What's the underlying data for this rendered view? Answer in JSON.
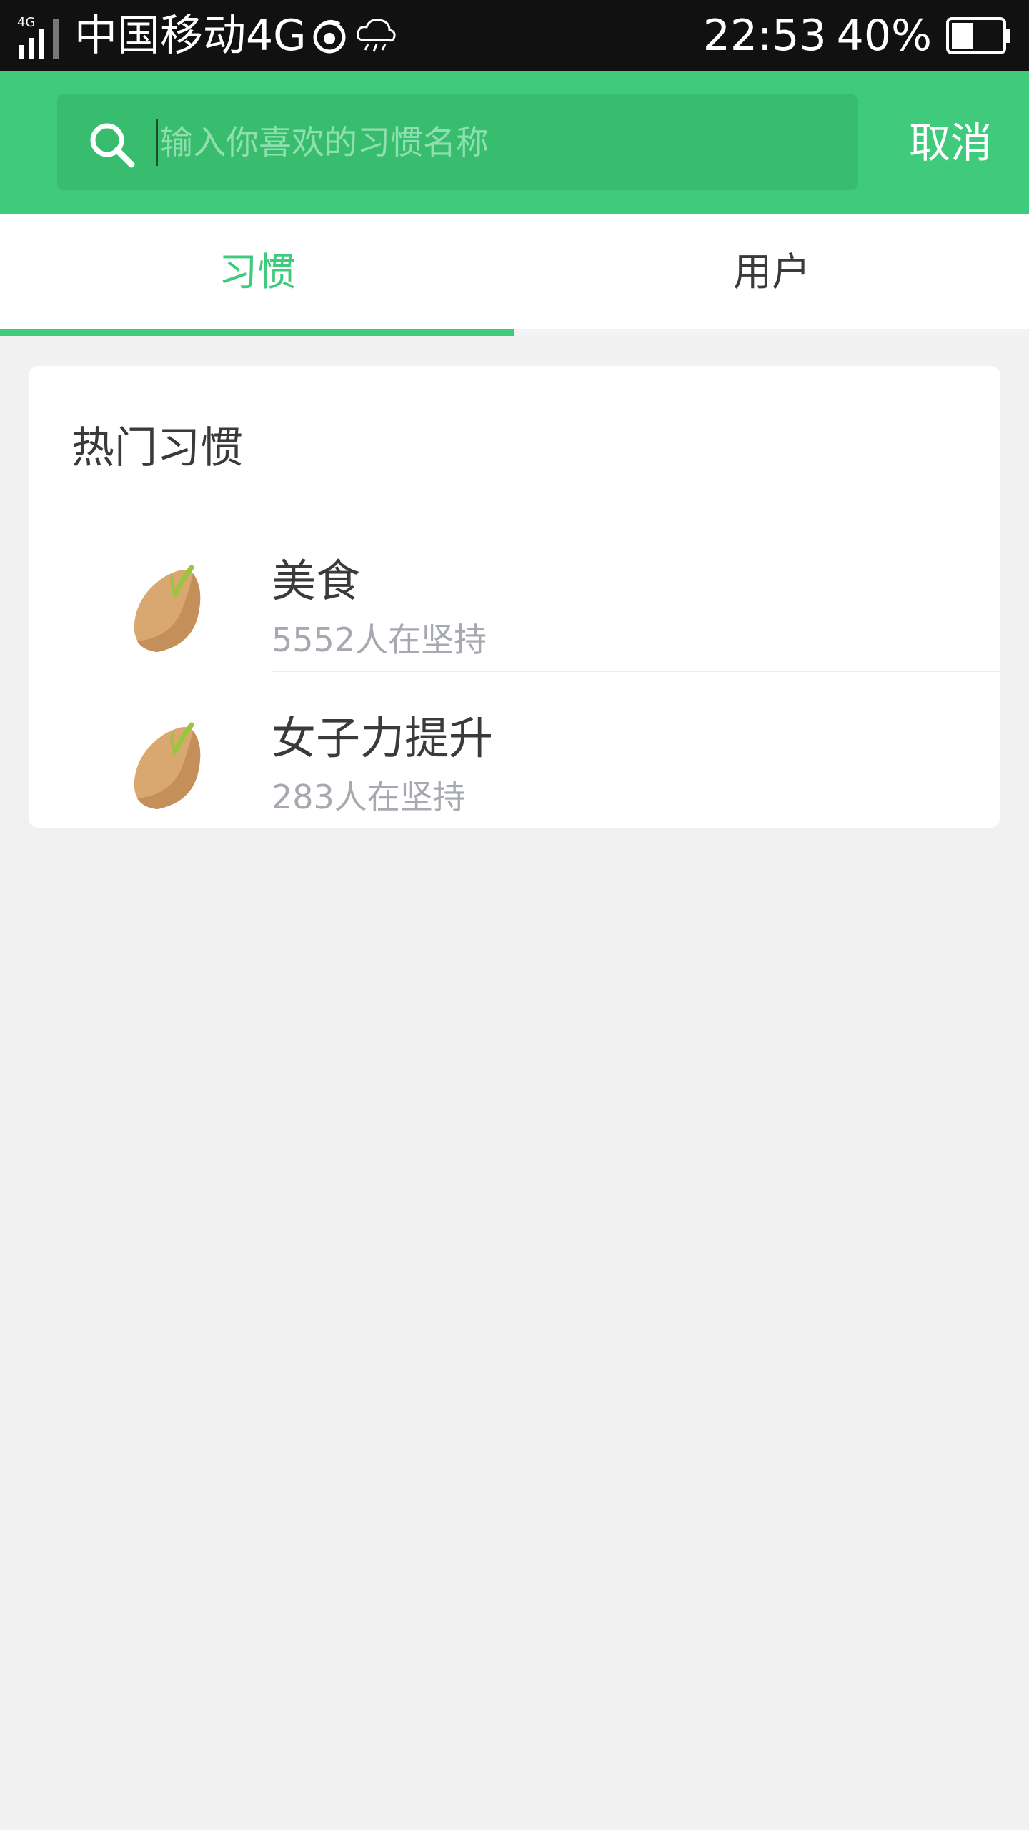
{
  "status_bar": {
    "carrier": "中国移动4G",
    "time": "22:53",
    "battery": "40%"
  },
  "search": {
    "placeholder": "输入你喜欢的习惯名称",
    "cancel_label": "取消"
  },
  "tabs": [
    {
      "label": "习惯",
      "active": true
    },
    {
      "label": "用户",
      "active": false
    }
  ],
  "hot_habits": {
    "title": "热门习惯",
    "items": [
      {
        "name": "美食",
        "count": "5552人在坚持",
        "icon": "seed-icon"
      },
      {
        "name": "女子力提升",
        "count": "283人在坚持",
        "icon": "seed-icon"
      }
    ]
  },
  "colors": {
    "brand_green": "#40cb7c",
    "search_bg": "#38bd6e",
    "muted_text": "#a6a9b0"
  }
}
